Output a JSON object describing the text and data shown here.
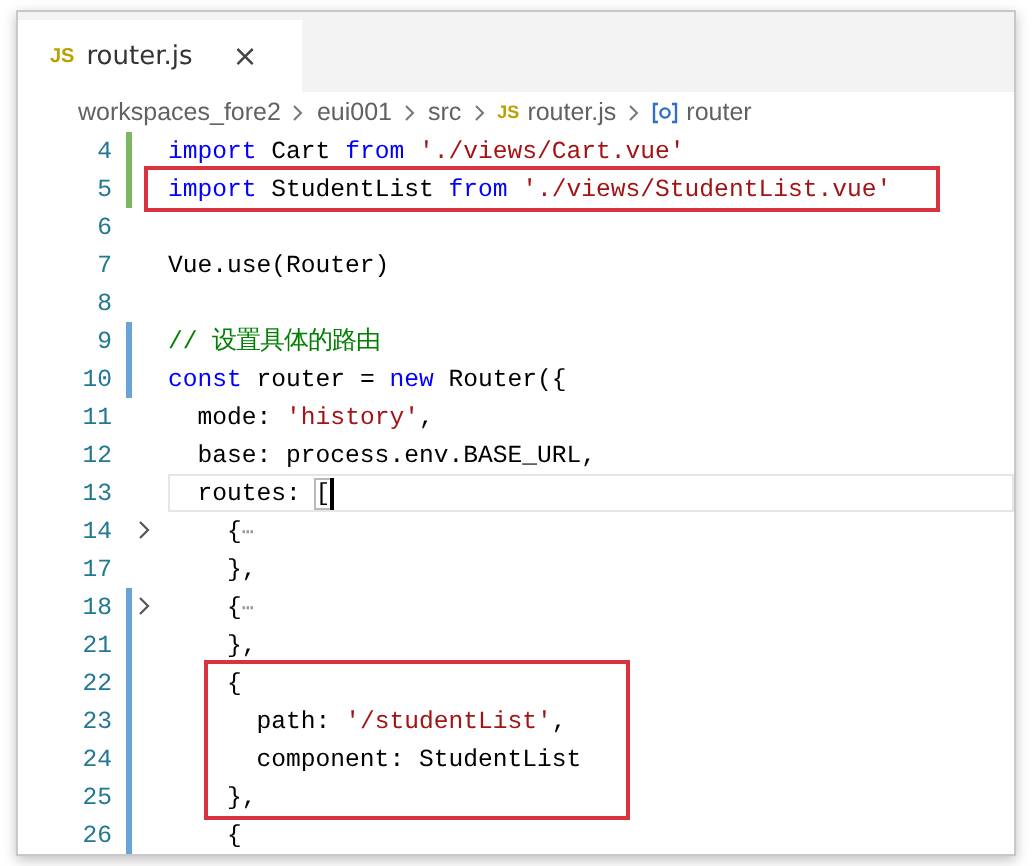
{
  "tab": {
    "icon_text": "JS",
    "label": "router.js",
    "close": "×",
    "selected": true
  },
  "breadcrumb": [
    {
      "text": "workspaces_fore2",
      "kind": "folder"
    },
    {
      "text": "eui001",
      "kind": "folder"
    },
    {
      "text": "src",
      "kind": "folder"
    },
    {
      "text": "router.js",
      "kind": "file",
      "icon_text": "JS"
    },
    {
      "text": "router",
      "kind": "symbol"
    }
  ],
  "lines": [
    {
      "number": "4",
      "color": "#7bb661",
      "folded": false,
      "boxed": false,
      "cursor": false,
      "tokens": [
        {
          "text": "import",
          "kind": "keyword"
        },
        {
          "text": " Cart ",
          "kind": "plain"
        },
        {
          "text": "from",
          "kind": "keyword"
        },
        {
          "text": " './views/Cart.vue'",
          "kind": "string"
        }
      ]
    },
    {
      "number": "5",
      "color": "#7bb661",
      "folded": false,
      "boxed": true,
      "cursor": false,
      "tokens": [
        {
          "text": "import",
          "kind": "keyword"
        },
        {
          "text": " StudentList ",
          "kind": "plain"
        },
        {
          "text": "from",
          "kind": "keyword"
        },
        {
          "text": " './views/StudentList.vue'",
          "kind": "string"
        }
      ]
    },
    {
      "number": "6",
      "folded": false,
      "boxed": false,
      "cursor": false
    },
    {
      "number": "7",
      "folded": false,
      "boxed": false,
      "cursor": false,
      "tokens": [
        {
          "text": "Vue.use(Router)",
          "kind": "plain"
        }
      ]
    },
    {
      "number": "8",
      "folded": false,
      "boxed": false,
      "cursor": false
    },
    {
      "number": "9",
      "color": "#6aa3d8",
      "folded": false,
      "boxed": false,
      "cursor": false,
      "tokens": [
        {
          "text": "// 设置具体的路由",
          "kind": "comment"
        }
      ]
    },
    {
      "number": "10",
      "color": "#6aa3d8",
      "folded": false,
      "boxed": false,
      "cursor": false,
      "tokens": [
        {
          "text": "const",
          "kind": "keyword"
        },
        {
          "text": " router = ",
          "kind": "plain"
        },
        {
          "text": "new",
          "kind": "keyword"
        },
        {
          "text": " Router({",
          "kind": "plain"
        }
      ]
    },
    {
      "number": "11",
      "folded": false,
      "boxed": false,
      "cursor": false,
      "tokens": [
        {
          "text": "  mode: ",
          "kind": "plain"
        },
        {
          "text": "'history'",
          "kind": "string"
        },
        {
          "text": ",",
          "kind": "plain"
        }
      ]
    },
    {
      "number": "12",
      "folded": false,
      "boxed": false,
      "cursor": false,
      "tokens": [
        {
          "text": "  base: process.env.BASE_URL,",
          "kind": "plain"
        }
      ]
    },
    {
      "number": "13",
      "folded": false,
      "boxed": false,
      "cursor": true,
      "tokens": [
        {
          "text": "  routes: ",
          "kind": "plain"
        },
        {
          "text": "[",
          "kind": "bracket"
        }
      ]
    },
    {
      "number": "14",
      "folded": true,
      "boxed": false,
      "cursor": false,
      "tokens": [
        {
          "text": "    {",
          "kind": "plain"
        },
        {
          "text": "⋯",
          "kind": "fold"
        }
      ]
    },
    {
      "number": "17",
      "folded": false,
      "boxed": false,
      "cursor": false,
      "tokens": [
        {
          "text": "    },",
          "kind": "plain"
        }
      ]
    },
    {
      "number": "18",
      "color": "#6aa3d8",
      "folded": true,
      "boxed": false,
      "cursor": false,
      "tokens": [
        {
          "text": "    {",
          "kind": "plain"
        },
        {
          "text": "⋯",
          "kind": "fold"
        }
      ]
    },
    {
      "number": "21",
      "color": "#6aa3d8",
      "folded": false,
      "boxed": false,
      "cursor": false,
      "tokens": [
        {
          "text": "    },",
          "kind": "plain"
        }
      ]
    },
    {
      "number": "22",
      "color": "#6aa3d8",
      "folded": false,
      "boxed": true,
      "cursor": false,
      "tokens": [
        {
          "text": "    {",
          "kind": "plain"
        }
      ]
    },
    {
      "number": "23",
      "color": "#6aa3d8",
      "folded": false,
      "boxed": true,
      "cursor": false,
      "tokens": [
        {
          "text": "      path: ",
          "kind": "plain"
        },
        {
          "text": "'/studentList'",
          "kind": "string"
        },
        {
          "text": ",",
          "kind": "plain"
        }
      ]
    },
    {
      "number": "24",
      "color": "#6aa3d8",
      "folded": false,
      "boxed": true,
      "cursor": false,
      "tokens": [
        {
          "text": "      component: StudentList",
          "kind": "plain"
        }
      ]
    },
    {
      "number": "25",
      "color": "#6aa3d8",
      "folded": false,
      "boxed": true,
      "cursor": false,
      "tokens": [
        {
          "text": "    },",
          "kind": "plain"
        }
      ]
    },
    {
      "number": "26",
      "color": "#6aa3d8",
      "folded": false,
      "boxed": false,
      "cursor": false,
      "tokens": [
        {
          "text": "    {",
          "kind": "plain"
        }
      ]
    }
  ]
}
